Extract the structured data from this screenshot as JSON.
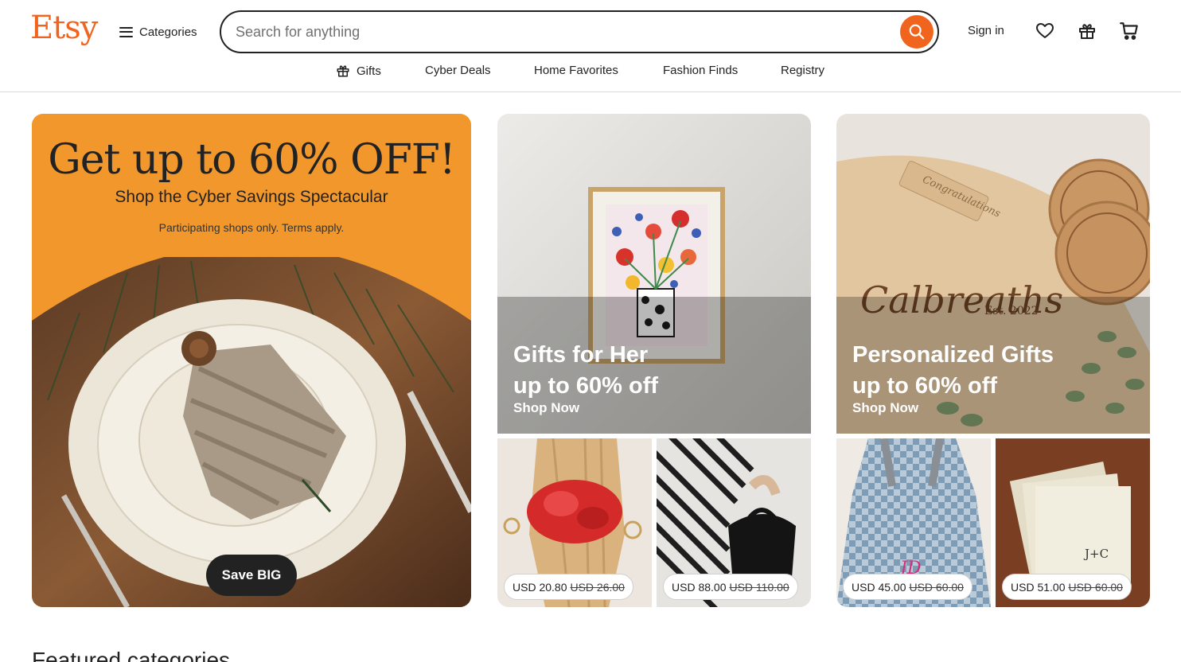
{
  "header": {
    "logo": "Etsy",
    "categories_label": "Categories",
    "search": {
      "placeholder": "Search for anything",
      "value": ""
    },
    "sign_in": "Sign in",
    "icons": [
      "menu-icon",
      "search-icon",
      "heart-icon",
      "gift-icon",
      "cart-icon"
    ]
  },
  "subnav": {
    "items": [
      {
        "label": "Gifts",
        "icon": "gift-icon"
      },
      {
        "label": "Cyber Deals"
      },
      {
        "label": "Home Favorites"
      },
      {
        "label": "Fashion Finds"
      },
      {
        "label": "Registry"
      }
    ]
  },
  "hero": {
    "title": "Get up to 60% OFF!",
    "subtitle": "Shop the Cyber Savings Spectacular",
    "note": "Participating shops only. Terms apply.",
    "button": "Save BIG",
    "background_color": "#f1972b"
  },
  "promos": [
    {
      "line1": "Gifts for Her",
      "line2": "up to 60% off",
      "link": "Shop Now",
      "tiles": [
        {
          "price": "USD 20.80",
          "original": "USD 26.00"
        },
        {
          "price": "USD 88.00",
          "original": "USD 110.00"
        }
      ]
    },
    {
      "line1": "Personalized Gifts",
      "line2": "up to 60% off",
      "link": "Shop Now",
      "artwork_text": "Calbreaths",
      "artwork_subtext": "Est. 2022",
      "tiles": [
        {
          "price": "USD 45.00",
          "original": "USD 60.00",
          "artwork_text": "JD"
        },
        {
          "price": "USD 51.00",
          "original": "USD 60.00",
          "artwork_text": "J+C"
        }
      ]
    }
  ],
  "section_heading": "Featured categories",
  "colors": {
    "accent": "#f1641e",
    "text": "#222222",
    "hero_bg": "#f1972b"
  }
}
